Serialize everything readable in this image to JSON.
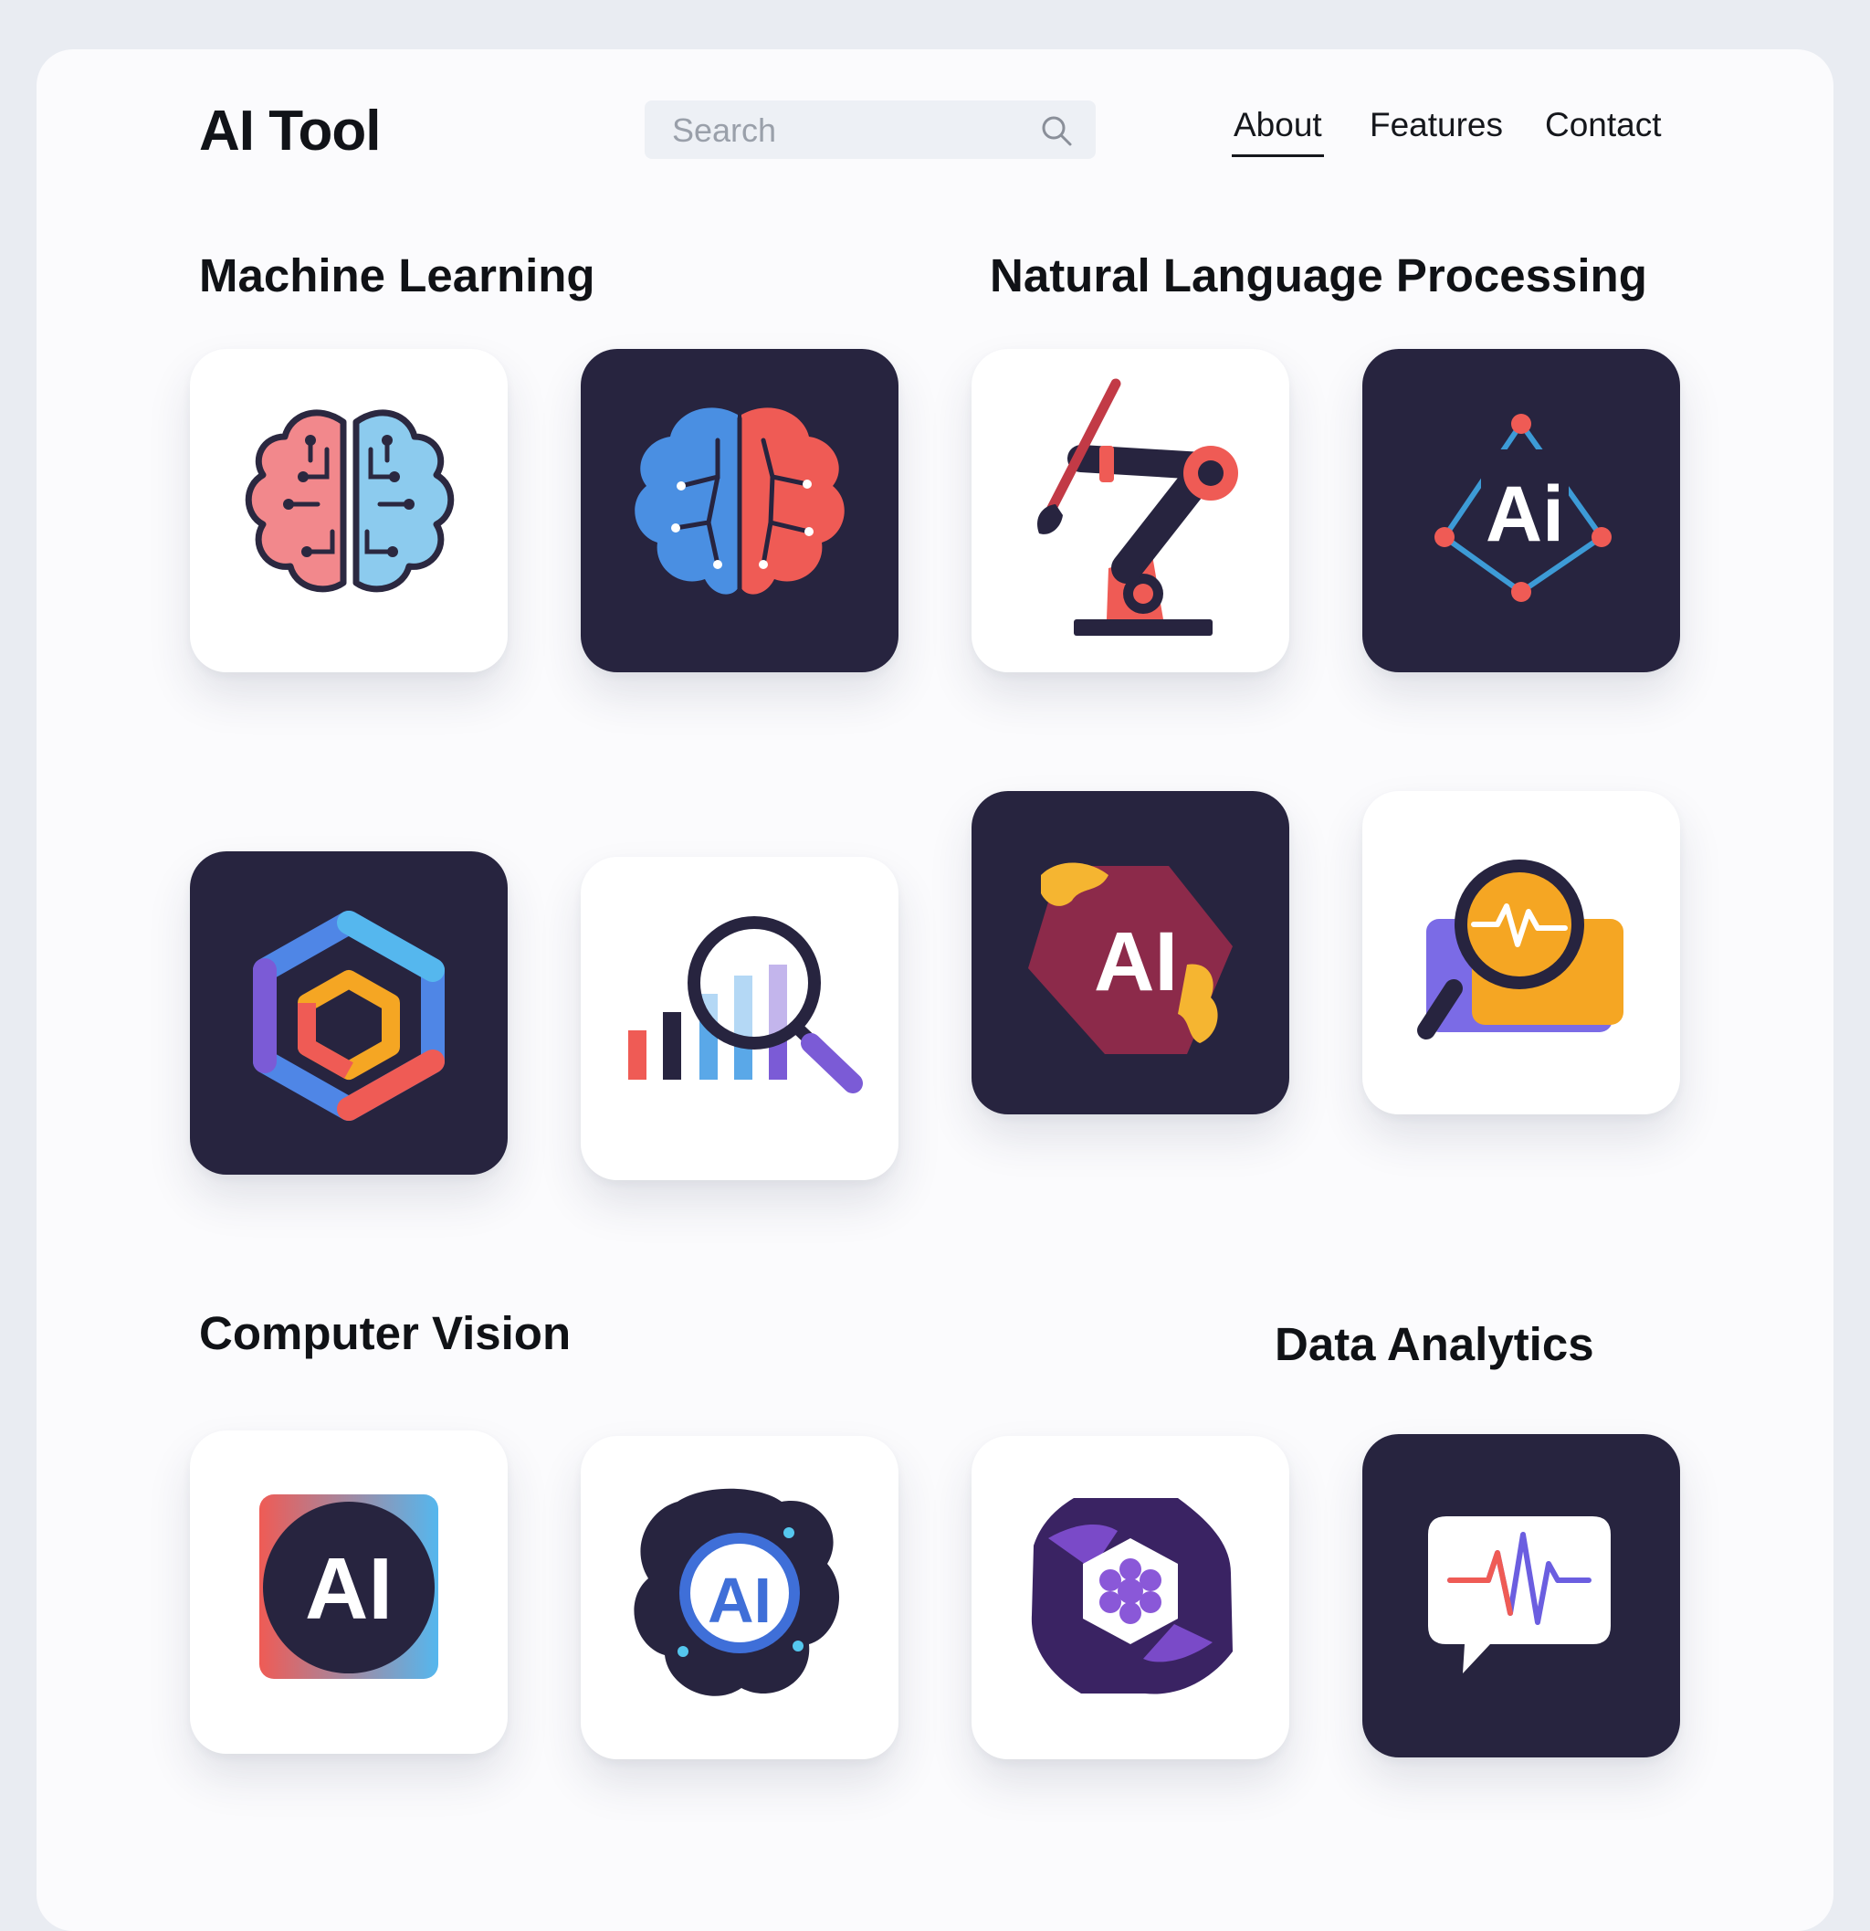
{
  "header": {
    "logo": "AI Tool",
    "search": {
      "placeholder": "Search",
      "value": "",
      "icon": "search-icon"
    },
    "nav": [
      {
        "label": "About",
        "active": true
      },
      {
        "label": "Features",
        "active": false
      },
      {
        "label": "Contact",
        "active": false
      }
    ]
  },
  "sections": [
    {
      "title": "Machine Learning"
    },
    {
      "title": "Natural Language Processing"
    },
    {
      "title": "Computer Vision"
    },
    {
      "title": "Data Analytics"
    }
  ],
  "tiles": {
    "brain_circuit_light": {
      "icon": "brain-circuit-icon",
      "theme": "light"
    },
    "brain_circuit_dark": {
      "icon": "brain-network-icon",
      "theme": "dark"
    },
    "robot_arm": {
      "icon": "robot-arm-paintbrush-icon",
      "theme": "light"
    },
    "ai_nodes": {
      "icon": "ai-nodes-icon",
      "theme": "dark",
      "text": "Ai"
    },
    "hexagon": {
      "icon": "hexagon-logo-icon",
      "theme": "dark"
    },
    "bar_chart_search": {
      "icon": "bar-chart-magnifier-icon",
      "theme": "light"
    },
    "ai_tag": {
      "icon": "ai-tag-icon",
      "theme": "dark",
      "text": "AI"
    },
    "wave_magnifier": {
      "icon": "pulse-magnifier-icon",
      "theme": "light"
    },
    "ai_square": {
      "icon": "ai-square-icon",
      "theme": "light",
      "text": "AI"
    },
    "ai_blob": {
      "icon": "ai-blob-icon",
      "theme": "light",
      "text": "AI"
    },
    "flower_hex": {
      "icon": "flower-hexagon-icon",
      "theme": "light"
    },
    "chat_pulse": {
      "icon": "chat-pulse-icon",
      "theme": "dark"
    }
  },
  "colors": {
    "dark_tile": "#27243f",
    "red": "#f0625a",
    "blue": "#5aa8e8",
    "orange": "#f5a623",
    "purple": "#7b5bd6"
  }
}
